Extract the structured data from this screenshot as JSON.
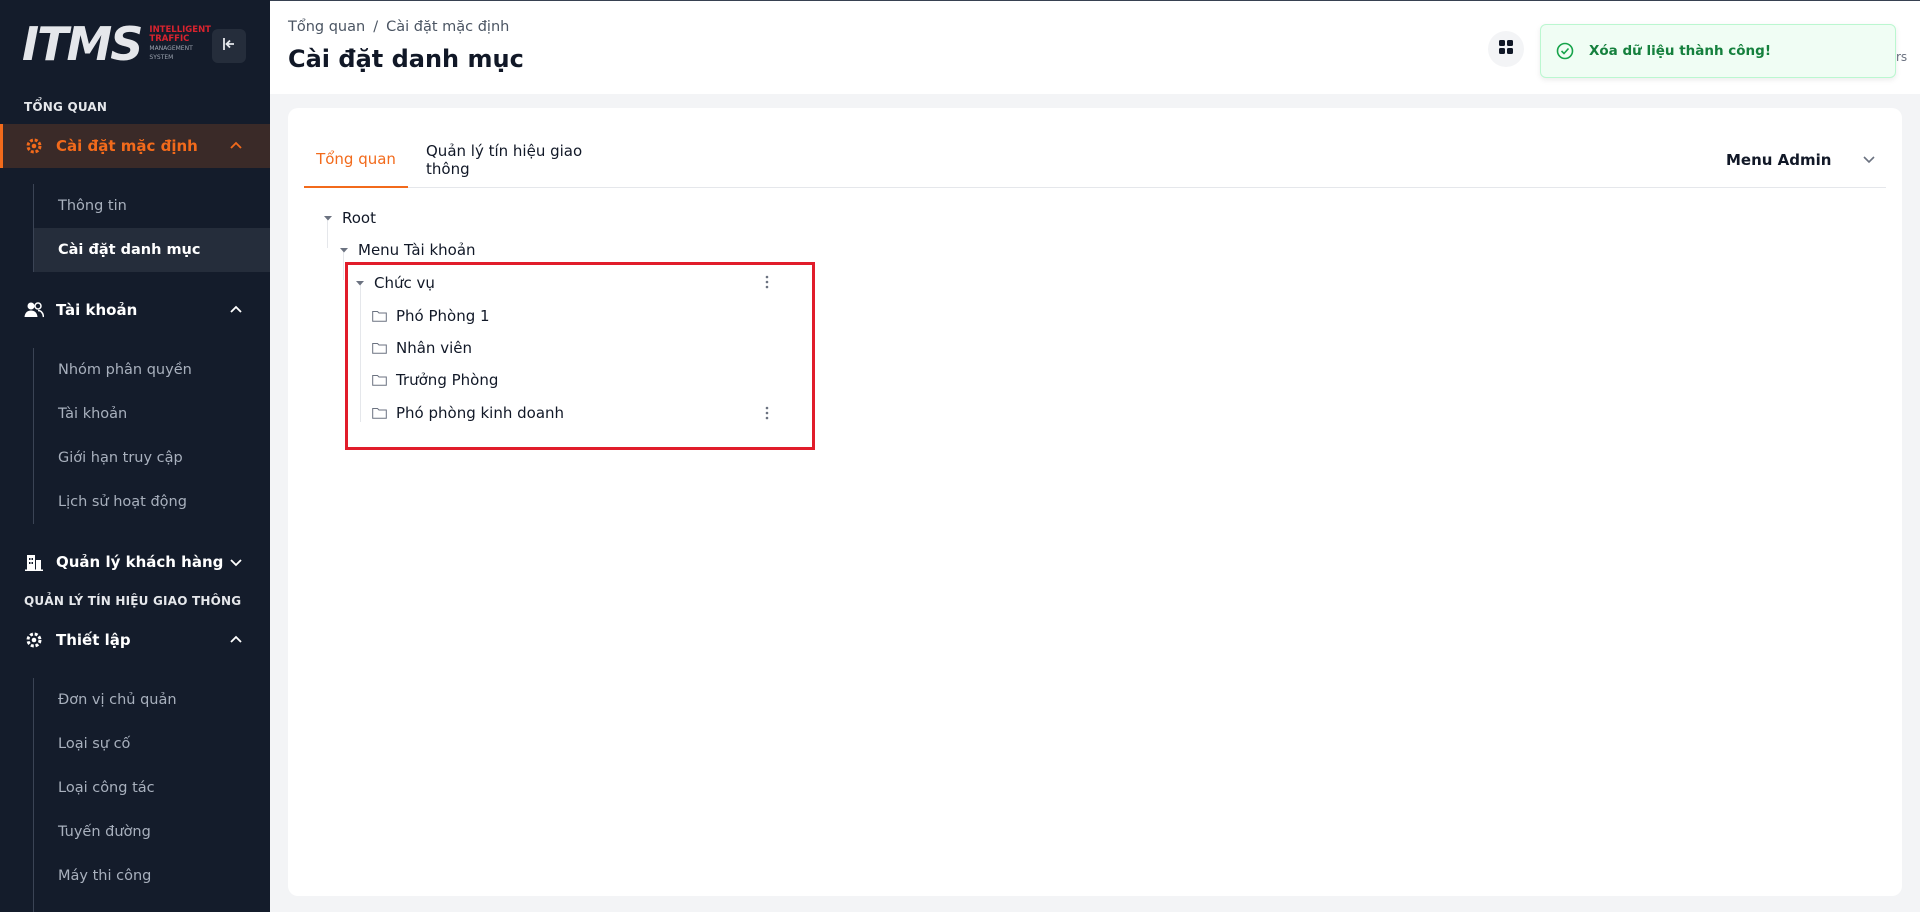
{
  "brand": {
    "logo": "ITMS",
    "tagline_line1": "INTELLIGENT",
    "tagline_line2": "TRAFFIC",
    "tagline_line3": "MANAGEMENT",
    "tagline_line4": "SYSTEM"
  },
  "sidebar": {
    "section_overview": "TỔNG QUAN",
    "group_default": {
      "label": "Cài đặt mặc định",
      "icon": "gear-icon"
    },
    "default_items": [
      {
        "label": "Thông tin"
      },
      {
        "label": "Cài đặt danh mục"
      }
    ],
    "group_account": {
      "label": "Tài khoản",
      "icon": "users-icon"
    },
    "account_items": [
      {
        "label": "Nhóm phân quyền"
      },
      {
        "label": "Tài khoản"
      },
      {
        "label": "Giới hạn truy cập"
      },
      {
        "label": "Lịch sử hoạt động"
      }
    ],
    "group_customers": {
      "label": "Quản lý khách hàng",
      "icon": "building-icon"
    },
    "section_traffic": "QUẢN LÝ TÍN HIỆU GIAO THÔNG",
    "group_setup": {
      "label": "Thiết lập",
      "icon": "gear-icon"
    },
    "setup_items": [
      {
        "label": "Đơn vị chủ quản"
      },
      {
        "label": "Loại sự cố"
      },
      {
        "label": "Loại công tác"
      },
      {
        "label": "Tuyến đường"
      },
      {
        "label": "Máy thi công"
      }
    ]
  },
  "header": {
    "breadcrumb": [
      "Tổng quan",
      "/",
      "Cài đặt mặc định"
    ],
    "title": "Cài đặt danh mục",
    "peek_text": "rs"
  },
  "toast": {
    "message": "Xóa dữ liệu thành công!"
  },
  "tabs": [
    {
      "label": "Tổng quan"
    },
    {
      "label": "Quản lý tín hiệu giao thông"
    }
  ],
  "menu_select": {
    "value": "Menu Admin"
  },
  "tree": {
    "root": "Root",
    "menu_account": "Menu Tài khoản",
    "position": "Chức vụ",
    "children": [
      {
        "label": "Phó Phòng 1"
      },
      {
        "label": "Nhân viên"
      },
      {
        "label": "Trưởng Phòng"
      },
      {
        "label": "Phó phòng kinh doanh"
      }
    ]
  },
  "colors": {
    "accent": "#f26a1b",
    "sidebar_bg": "#141c2b",
    "success": "#15803d",
    "highlight": "#e11d2a"
  }
}
